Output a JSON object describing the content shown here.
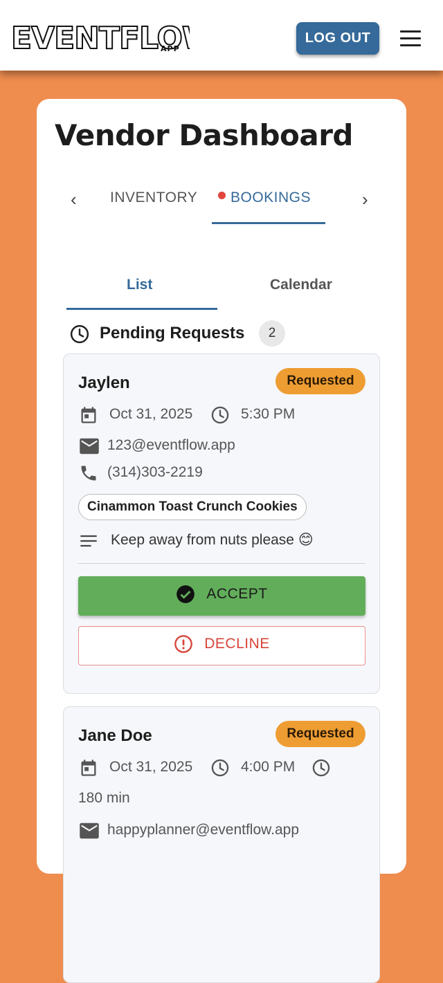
{
  "header": {
    "logo_text": "EVENTFLOW",
    "logo_suffix": "APP",
    "logout_label": "LOG OUT"
  },
  "page": {
    "title": "Vendor Dashboard"
  },
  "tabs": [
    {
      "label": "INVENTORY",
      "active": false
    },
    {
      "label": "BOOKINGS",
      "active": true,
      "has_dot": true
    }
  ],
  "subtabs": [
    {
      "label": "List",
      "active": true
    },
    {
      "label": "Calendar",
      "active": false
    }
  ],
  "pending": {
    "title": "Pending Requests",
    "count": "2"
  },
  "bookings": [
    {
      "name": "Jaylen",
      "status": "Requested",
      "date": "Oct 31, 2025",
      "time": "5:30 PM",
      "email": "123@eventflow.app",
      "phone": "(314)303-2219",
      "item": "Cinammon Toast Crunch Cookies",
      "note": "Keep away from nuts please 😊",
      "accept_label": "ACCEPT",
      "decline_label": "DECLINE"
    },
    {
      "name": "Jane Doe",
      "status": "Requested",
      "date": "Oct 31, 2025",
      "time": "4:00 PM",
      "duration": "180 min",
      "email": "happyplanner@eventflow.app"
    }
  ],
  "colors": {
    "background": "#EF8D4F",
    "primary": "#356A9A",
    "status_badge": "#EE9D33",
    "accept": "#62AD5A",
    "decline": "#D8453A",
    "tab_dot": "#E2453C"
  }
}
